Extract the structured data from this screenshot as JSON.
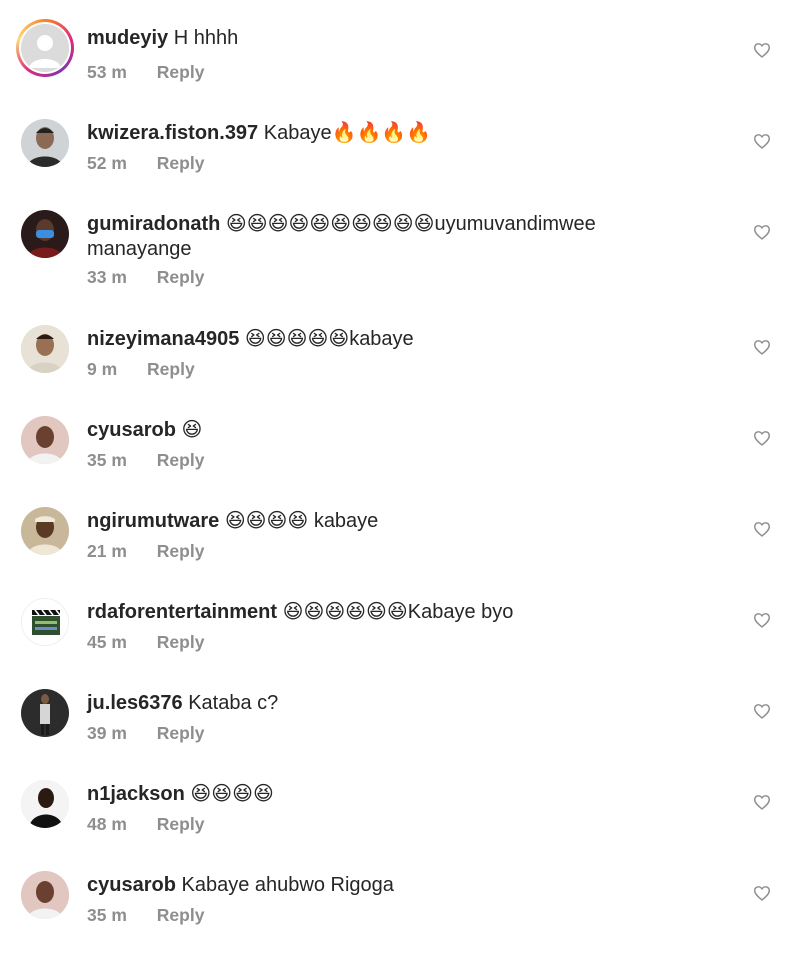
{
  "comments": [
    {
      "username": "mudeyiy",
      "text": "H hhhh",
      "time": "53 m",
      "reply": "Reply",
      "avatar": "default-avatar-icon",
      "story_ring": true,
      "emoji": []
    },
    {
      "username": "kwizera.fiston.397",
      "text": "Kabaye",
      "time": "52 m",
      "reply": "Reply",
      "avatar": "photo",
      "story_ring": false,
      "emoji": [
        "🔥",
        "🔥",
        "🔥",
        "🔥"
      ]
    },
    {
      "username": "gumiradonath",
      "text": "uyumuvandimwee",
      "text2": "manayange",
      "time": "33 m",
      "reply": "Reply",
      "avatar": "photo",
      "story_ring": false,
      "emoji": [
        "😆",
        "😆",
        "😆",
        "😆",
        "😆",
        "😆",
        "😆",
        "😆",
        "😆",
        "😆"
      ]
    },
    {
      "username": "nizeyimana4905",
      "text": "kabaye",
      "time": "9 m",
      "reply": "Reply",
      "avatar": "photo",
      "story_ring": false,
      "emoji": [
        "😆",
        "😆",
        "😆",
        "😆",
        "😆"
      ]
    },
    {
      "username": "cyusarob",
      "text": "",
      "time": "35 m",
      "reply": "Reply",
      "avatar": "photo",
      "story_ring": false,
      "emoji": [
        "😆"
      ]
    },
    {
      "username": "ngirumutware",
      "text": "kabaye",
      "time": "21 m",
      "reply": "Reply",
      "avatar": "photo",
      "story_ring": false,
      "emoji": [
        "😆",
        "😆",
        "😆",
        "😆"
      ]
    },
    {
      "username": "rdaforentertainment",
      "text": "Kabaye byo",
      "time": "45 m",
      "reply": "Reply",
      "avatar": "clapperboard-logo",
      "story_ring": false,
      "emoji": [
        "😆",
        "😆",
        "😆",
        "😆",
        "😆",
        "😆"
      ]
    },
    {
      "username": "ju.les6376",
      "text": "Kataba c?",
      "time": "39 m",
      "reply": "Reply",
      "avatar": "photo",
      "story_ring": false,
      "emoji": []
    },
    {
      "username": "n1jackson",
      "text": "",
      "time": "48 m",
      "reply": "Reply",
      "avatar": "photo",
      "story_ring": false,
      "emoji": [
        "😆",
        "😆",
        "😆",
        "😆"
      ]
    },
    {
      "username": "cyusarob",
      "text": "Kabaye ahubwo Rigoga",
      "time": "35 m",
      "reply": "Reply",
      "avatar": "photo",
      "story_ring": false,
      "emoji": []
    }
  ],
  "icons": {
    "like": "heart-outline-icon"
  },
  "colors": {
    "username": "#262626",
    "meta": "#8e8e8e",
    "heart": "#8e8e8e"
  }
}
